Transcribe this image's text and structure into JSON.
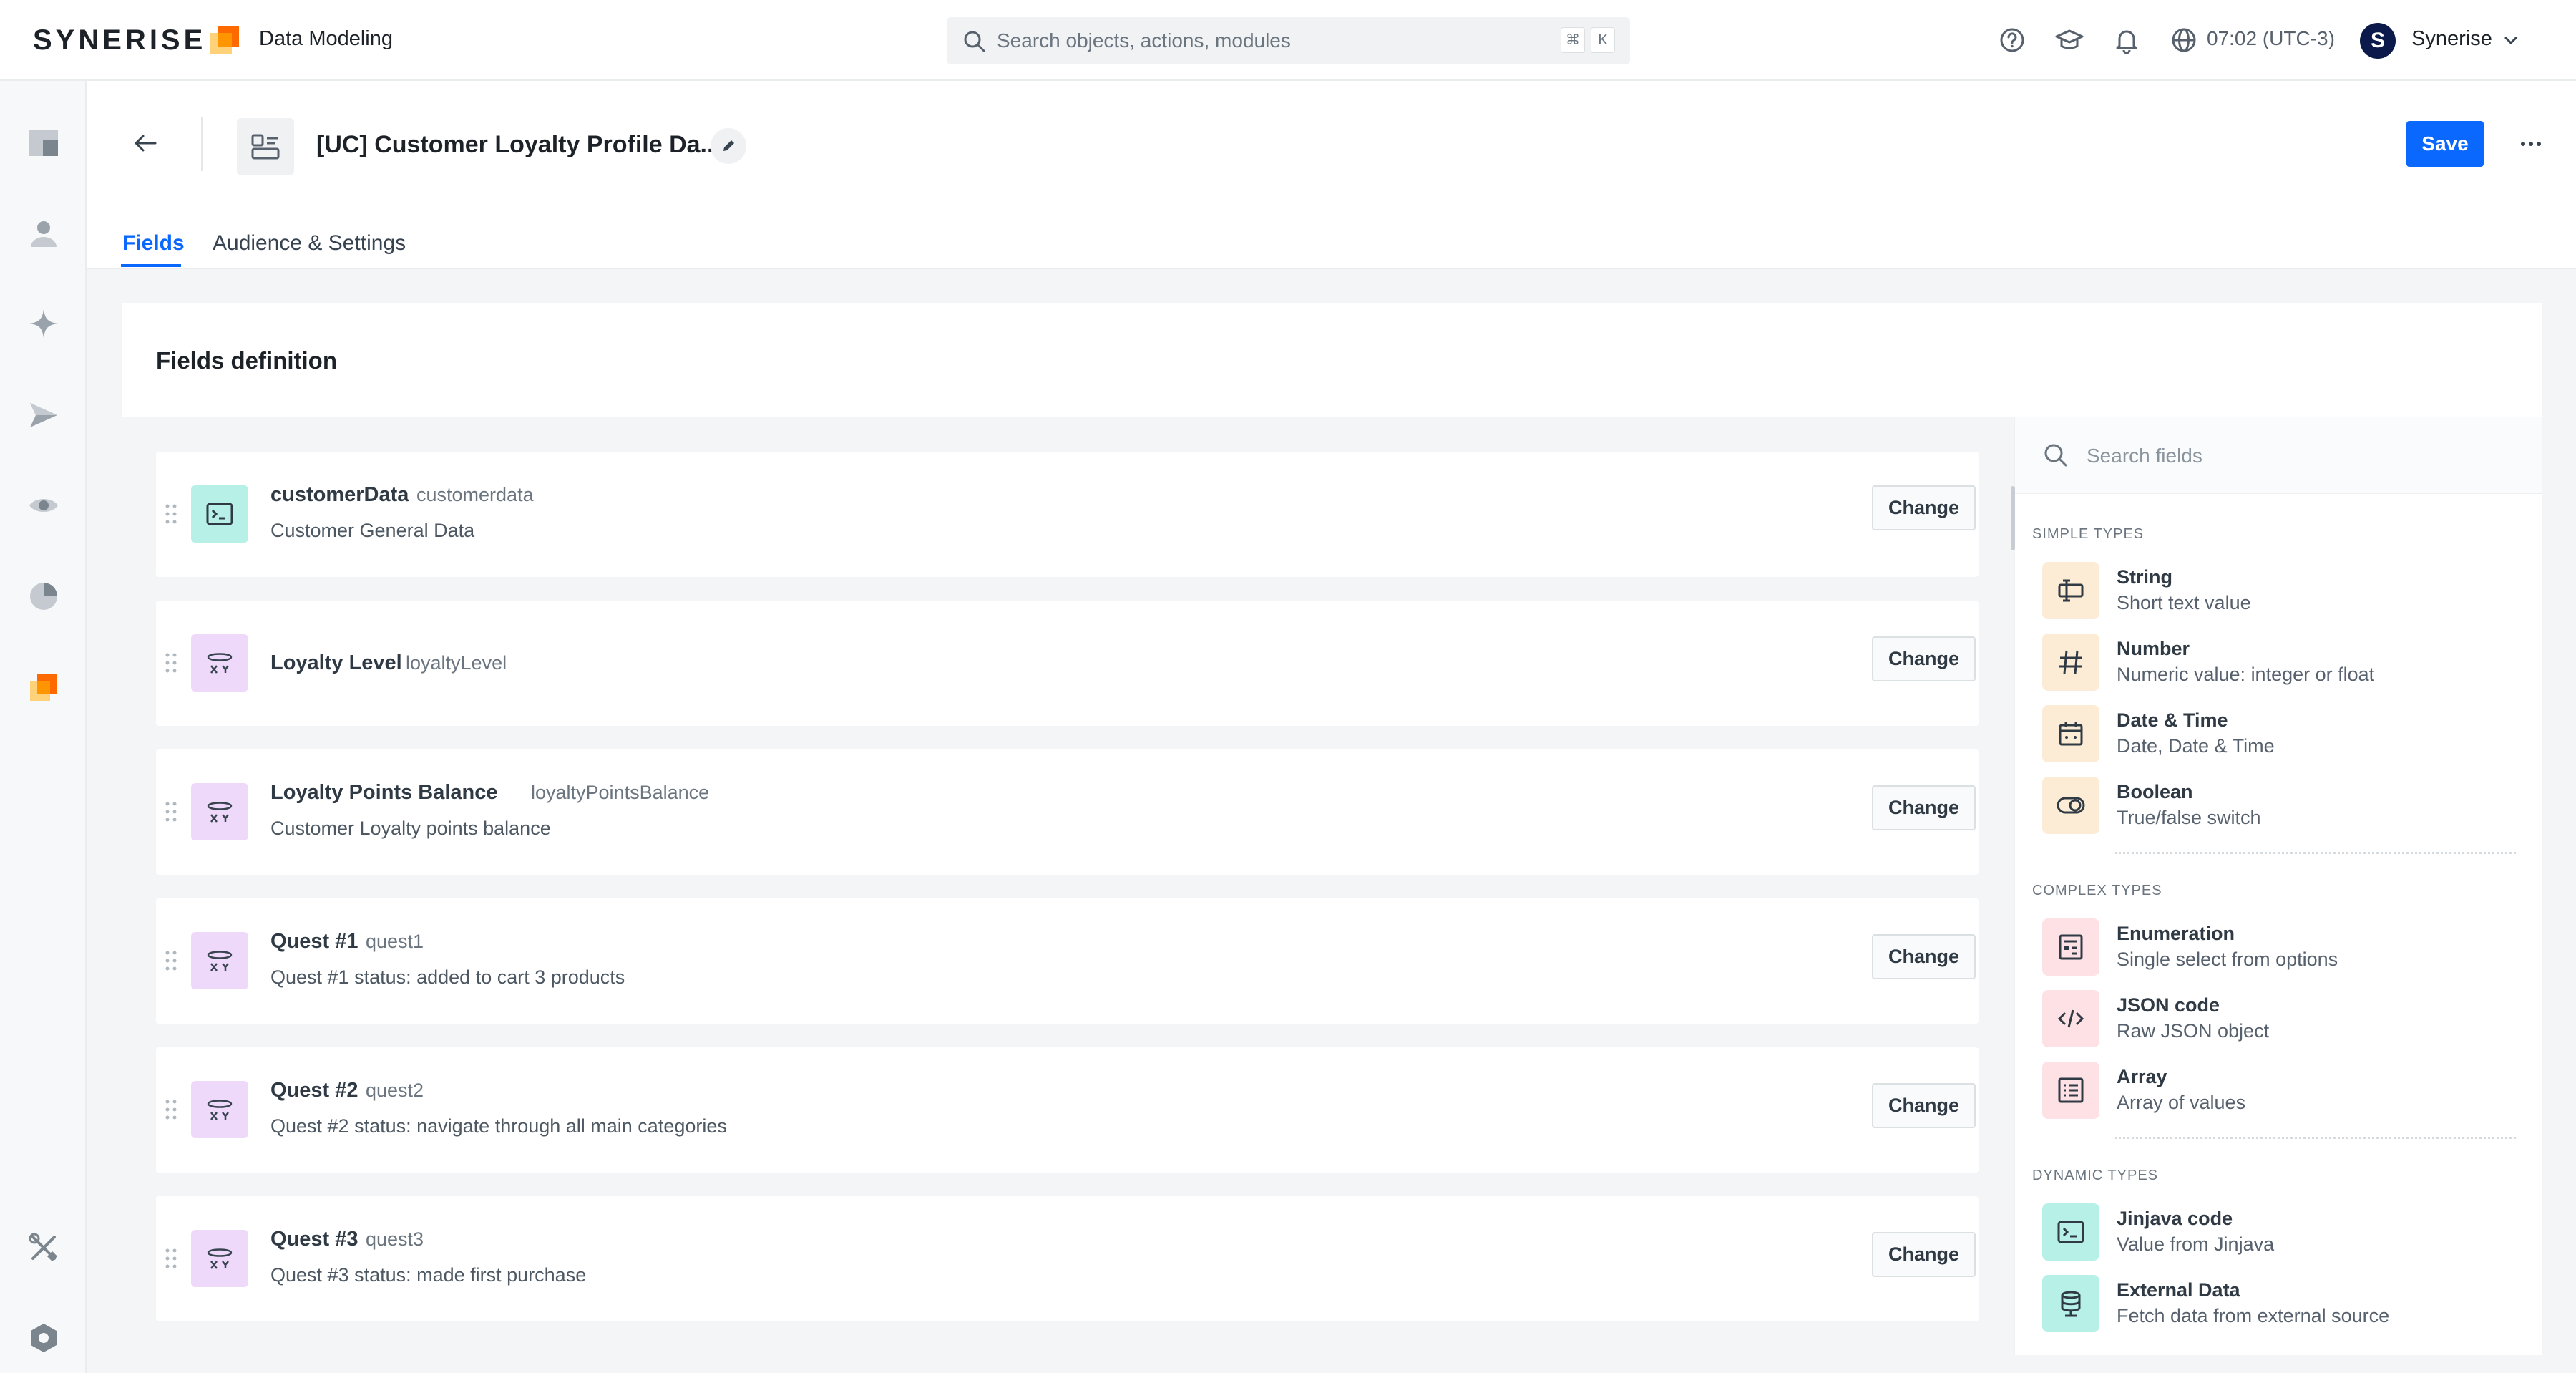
{
  "app": {
    "logo": "SYNERISE",
    "module_name": "Data Modeling",
    "brand_colors": [
      "#ffb400",
      "#ff5a00"
    ]
  },
  "topbar": {
    "search_placeholder": "Search objects, actions, modules",
    "shortcut_keys": [
      "⌘",
      "K"
    ],
    "icons": [
      "help-icon",
      "graduation-cap-icon",
      "bell-icon",
      "globe-icon"
    ],
    "time": "07:02 (UTC-3)",
    "user": {
      "avatar_letter": "S",
      "name": "Synerise"
    }
  },
  "sidebar": {
    "items": [
      "dashboard-icon",
      "profile-icon",
      "ai-sparkle-icon",
      "campaign-icon",
      "behavioral-data-icon",
      "analytics-icon",
      "data-modeling-icon",
      "tools-icon",
      "settings-icon"
    ]
  },
  "header": {
    "title": "[UC] Customer Loyalty Profile Da...",
    "save_label": "Save",
    "accent_color": "#0b68ff"
  },
  "tabs": [
    {
      "label": "Fields",
      "active": true
    },
    {
      "label": "Audience & Settings",
      "active": false
    }
  ],
  "card": {
    "title": "Fields definition",
    "change_label": "Change",
    "fields": [
      {
        "name": "customerData",
        "key": "customerdata",
        "description": "Customer General Data",
        "icon": "jinjava-icon"
      },
      {
        "name": "Loyalty Level",
        "key": "loyaltyLevel",
        "description": "",
        "icon": "formula-icon"
      },
      {
        "name": "Loyalty Points Balance",
        "key": "loyaltyPointsBalance",
        "description": "Customer Loyalty points balance",
        "icon": "formula-icon"
      },
      {
        "name": "Quest #1",
        "key": "quest1",
        "description": "Quest #1 status: added to cart 3 products",
        "icon": "formula-icon"
      },
      {
        "name": "Quest #2",
        "key": "quest2",
        "description": "Quest #2 status: navigate through all main categories",
        "icon": "formula-icon"
      },
      {
        "name": "Quest #3",
        "key": "quest3",
        "description": "Quest #3 status: made first purchase",
        "icon": "formula-icon"
      }
    ]
  },
  "types_panel": {
    "search_placeholder": "Search fields",
    "groups": [
      {
        "label": "SIMPLE TYPES",
        "items": [
          {
            "name": "String",
            "description": "Short text value",
            "icon": "text-cursor-icon"
          },
          {
            "name": "Number",
            "description": "Numeric value: integer or float",
            "icon": "hash-icon"
          },
          {
            "name": "Date & Time",
            "description": "Date, Date & Time",
            "icon": "calendar-icon"
          },
          {
            "name": "Boolean",
            "description": "True/false switch",
            "icon": "toggle-icon"
          }
        ]
      },
      {
        "label": "COMPLEX TYPES",
        "items": [
          {
            "name": "Enumeration",
            "description": "Single select from options",
            "icon": "enum-list-icon"
          },
          {
            "name": "JSON code",
            "description": "Raw JSON object",
            "icon": "code-icon"
          },
          {
            "name": "Array",
            "description": "Array of values",
            "icon": "array-list-icon"
          }
        ]
      },
      {
        "label": "DYNAMIC TYPES",
        "items": [
          {
            "name": "Jinjava code",
            "description": "Value from Jinjava",
            "icon": "jinjava-icon"
          },
          {
            "name": "External Data",
            "description": "Fetch data from external source",
            "icon": "database-icon"
          }
        ]
      }
    ]
  }
}
